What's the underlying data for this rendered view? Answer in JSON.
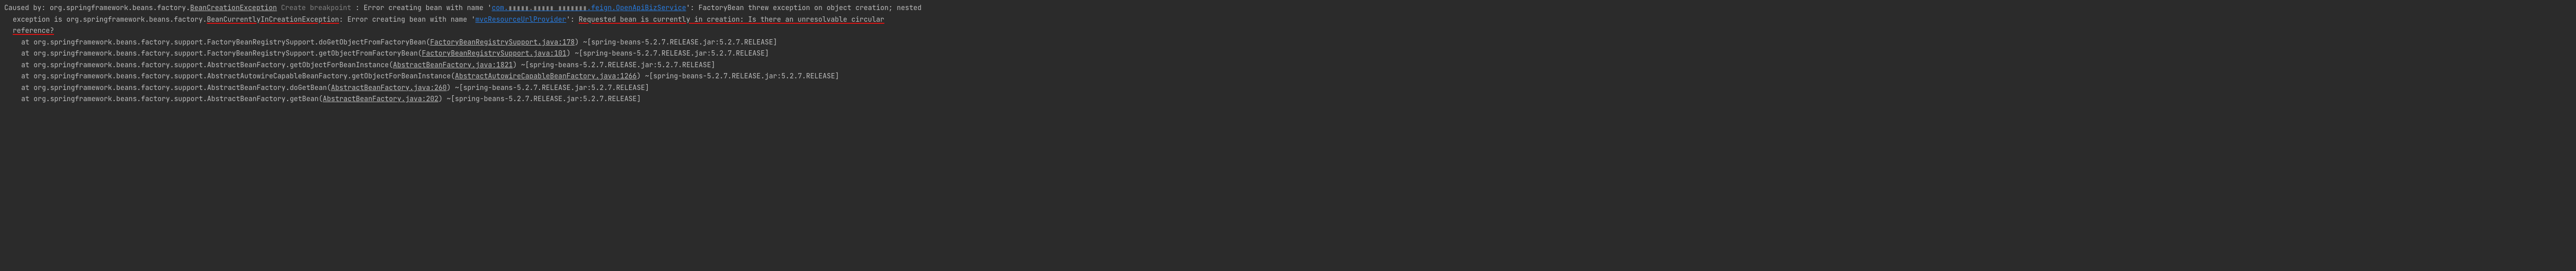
{
  "causedBy": {
    "prefix": "Caused by: ",
    "fqcn_part1": "org.springframework.beans.factory.",
    "exception1": "BeanCreationException",
    "breakpoint_label": " Create breakpoint ",
    "msg1": ": Error creating bean with name '",
    "link_service_pre": "com.",
    "link_service_mid": "▮▮▮▮▮.▮▮▮▮▮ ▮▮▮▮▮▮▮",
    "link_service_post": ".feign.OpenApiBizService",
    "msg2": "': FactoryBean threw exception on object creation; nested"
  },
  "causedByLine2": {
    "indent_text": "exception is org.springframework.beans.factory.",
    "exception2": "BeanCurrentlyInCreationException",
    "msg3": ": Error creating bean with name '",
    "bean_link": "mvcResourceUrlProvider",
    "msg4": "': ",
    "circular_msg": "Requested bean is currently in creation: Is there an unresolvable circular"
  },
  "causedByLine3": {
    "reference_q": "reference?"
  },
  "stack": [
    {
      "at": "at ",
      "method": "org.springframework.beans.factory.support.FactoryBeanRegistrySupport.doGetObjectFromFactoryBean(",
      "file_link": "FactoryBeanRegistrySupport.java:178",
      "suffix": ") ~[spring-beans-5.2.7.RELEASE.jar:5.2.7.RELEASE]"
    },
    {
      "at": "at ",
      "method": "org.springframework.beans.factory.support.FactoryBeanRegistrySupport.getObjectFromFactoryBean(",
      "file_link": "FactoryBeanRegistrySupport.java:101",
      "suffix": ") ~[spring-beans-5.2.7.RELEASE.jar:5.2.7.RELEASE]"
    },
    {
      "at": "at ",
      "method": "org.springframework.beans.factory.support.AbstractBeanFactory.getObjectForBeanInstance(",
      "file_link": "AbstractBeanFactory.java:1821",
      "suffix": ") ~[spring-beans-5.2.7.RELEASE.jar:5.2.7.RELEASE]"
    },
    {
      "at": "at ",
      "method": "org.springframework.beans.factory.support.AbstractAutowireCapableBeanFactory.getObjectForBeanInstance(",
      "file_link": "AbstractAutowireCapableBeanFactory.java:1266",
      "suffix": ") ~[spring-beans-5.2.7.RELEASE.jar:5.2.7.RELEASE]"
    },
    {
      "at": "at ",
      "method": "org.springframework.beans.factory.support.AbstractBeanFactory.doGetBean(",
      "file_link": "AbstractBeanFactory.java:260",
      "suffix": ") ~[spring-beans-5.2.7.RELEASE.jar:5.2.7.RELEASE]"
    },
    {
      "at": "at ",
      "method": "org.springframework.beans.factory.support.AbstractBeanFactory.getBean(",
      "file_link": "AbstractBeanFactory.java:202",
      "suffix": ") ~[spring-beans-5.2.7.RELEASE.jar:5.2.7.RELEASE]"
    }
  ]
}
